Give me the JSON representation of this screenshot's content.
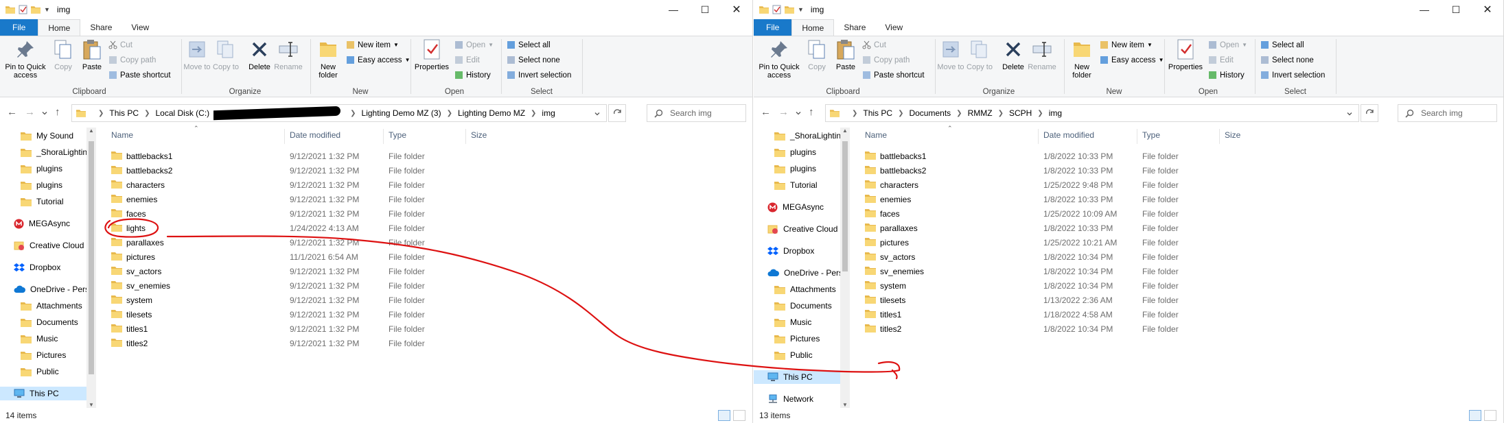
{
  "left": {
    "title": "img",
    "tabs": [
      "File",
      "Home",
      "Share",
      "View"
    ],
    "ribbon": {
      "clipboard": {
        "label": "Clipboard",
        "pin": "Pin to Quick access",
        "copy": "Copy",
        "paste": "Paste",
        "cut": "Cut",
        "copy_path": "Copy path",
        "paste_shortcut": "Paste shortcut"
      },
      "organize": {
        "label": "Organize",
        "move_to": "Move to",
        "copy_to": "Copy to",
        "delete": "Delete",
        "rename": "Rename"
      },
      "new": {
        "label": "New",
        "new_folder": "New folder",
        "new_item": "New item",
        "easy_access": "Easy access"
      },
      "open": {
        "label": "Open",
        "properties": "Properties",
        "open": "Open",
        "edit": "Edit",
        "history": "History"
      },
      "select": {
        "label": "Select",
        "select_all": "Select all",
        "select_none": "Select none",
        "invert_selection": "Invert selection"
      }
    },
    "address": [
      "This PC",
      "Local Disk (C:)",
      "Lighting Demo MZ (3)",
      "Lighting Demo MZ",
      "img"
    ],
    "search_placeholder": "Search img",
    "nav_items": [
      "My Sound",
      "_ShoraLightin",
      "plugins",
      "plugins",
      "Tutorial",
      "MEGAsync",
      "Creative Cloud",
      "Dropbox",
      "OneDrive - Pers",
      "Attachments",
      "Documents",
      "Music",
      "Pictures",
      "Public",
      "This PC"
    ],
    "columns": [
      "Name",
      "Date modified",
      "Type",
      "Size"
    ],
    "files": [
      {
        "name": "battlebacks1",
        "date": "9/12/2021 1:32 PM",
        "type": "File folder"
      },
      {
        "name": "battlebacks2",
        "date": "9/12/2021 1:32 PM",
        "type": "File folder"
      },
      {
        "name": "characters",
        "date": "9/12/2021 1:32 PM",
        "type": "File folder"
      },
      {
        "name": "enemies",
        "date": "9/12/2021 1:32 PM",
        "type": "File folder"
      },
      {
        "name": "faces",
        "date": "9/12/2021 1:32 PM",
        "type": "File folder"
      },
      {
        "name": "lights",
        "date": "1/24/2022 4:13 AM",
        "type": "File folder"
      },
      {
        "name": "parallaxes",
        "date": "9/12/2021 1:32 PM",
        "type": "File folder"
      },
      {
        "name": "pictures",
        "date": "11/1/2021 6:54 AM",
        "type": "File folder"
      },
      {
        "name": "sv_actors",
        "date": "9/12/2021 1:32 PM",
        "type": "File folder"
      },
      {
        "name": "sv_enemies",
        "date": "9/12/2021 1:32 PM",
        "type": "File folder"
      },
      {
        "name": "system",
        "date": "9/12/2021 1:32 PM",
        "type": "File folder"
      },
      {
        "name": "tilesets",
        "date": "9/12/2021 1:32 PM",
        "type": "File folder"
      },
      {
        "name": "titles1",
        "date": "9/12/2021 1:32 PM",
        "type": "File folder"
      },
      {
        "name": "titles2",
        "date": "9/12/2021 1:32 PM",
        "type": "File folder"
      }
    ],
    "status": "14 items"
  },
  "right": {
    "title": "img",
    "tabs": [
      "File",
      "Home",
      "Share",
      "View"
    ],
    "ribbon": {
      "clipboard": {
        "label": "Clipboard",
        "pin": "Pin to Quick access",
        "copy": "Copy",
        "paste": "Paste",
        "cut": "Cut",
        "copy_path": "Copy path",
        "paste_shortcut": "Paste shortcut"
      },
      "organize": {
        "label": "Organize",
        "move_to": "Move to",
        "copy_to": "Copy to",
        "delete": "Delete",
        "rename": "Rename"
      },
      "new": {
        "label": "New",
        "new_folder": "New folder",
        "new_item": "New item",
        "easy_access": "Easy access"
      },
      "open": {
        "label": "Open",
        "properties": "Properties",
        "open": "Open",
        "edit": "Edit",
        "history": "History"
      },
      "select": {
        "label": "Select",
        "select_all": "Select all",
        "select_none": "Select none",
        "invert_selection": "Invert selection"
      }
    },
    "address": [
      "This PC",
      "Documents",
      "RMMZ",
      "SCPH",
      "img"
    ],
    "search_placeholder": "Search img",
    "nav_items": [
      "_ShoraLightin",
      "plugins",
      "plugins",
      "Tutorial",
      "MEGAsync",
      "Creative Cloud",
      "Dropbox",
      "OneDrive - Pers",
      "Attachments",
      "Documents",
      "Music",
      "Pictures",
      "Public",
      "This PC",
      "Network"
    ],
    "columns": [
      "Name",
      "Date modified",
      "Type",
      "Size"
    ],
    "files": [
      {
        "name": "battlebacks1",
        "date": "1/8/2022 10:33 PM",
        "type": "File folder"
      },
      {
        "name": "battlebacks2",
        "date": "1/8/2022 10:33 PM",
        "type": "File folder"
      },
      {
        "name": "characters",
        "date": "1/25/2022 9:48 PM",
        "type": "File folder"
      },
      {
        "name": "enemies",
        "date": "1/8/2022 10:33 PM",
        "type": "File folder"
      },
      {
        "name": "faces",
        "date": "1/25/2022 10:09 AM",
        "type": "File folder"
      },
      {
        "name": "parallaxes",
        "date": "1/8/2022 10:33 PM",
        "type": "File folder"
      },
      {
        "name": "pictures",
        "date": "1/25/2022 10:21 AM",
        "type": "File folder"
      },
      {
        "name": "sv_actors",
        "date": "1/8/2022 10:34 PM",
        "type": "File folder"
      },
      {
        "name": "sv_enemies",
        "date": "1/8/2022 10:34 PM",
        "type": "File folder"
      },
      {
        "name": "system",
        "date": "1/8/2022 10:34 PM",
        "type": "File folder"
      },
      {
        "name": "tilesets",
        "date": "1/13/2022 2:36 AM",
        "type": "File folder"
      },
      {
        "name": "titles1",
        "date": "1/18/2022 4:58 AM",
        "type": "File folder"
      },
      {
        "name": "titles2",
        "date": "1/8/2022 10:34 PM",
        "type": "File folder"
      }
    ],
    "status": "13 items"
  },
  "colors": {
    "file_tab": "#1979ca",
    "selection": "#cce8ff",
    "annotation": "#dd1111",
    "redaction": "#000000"
  }
}
